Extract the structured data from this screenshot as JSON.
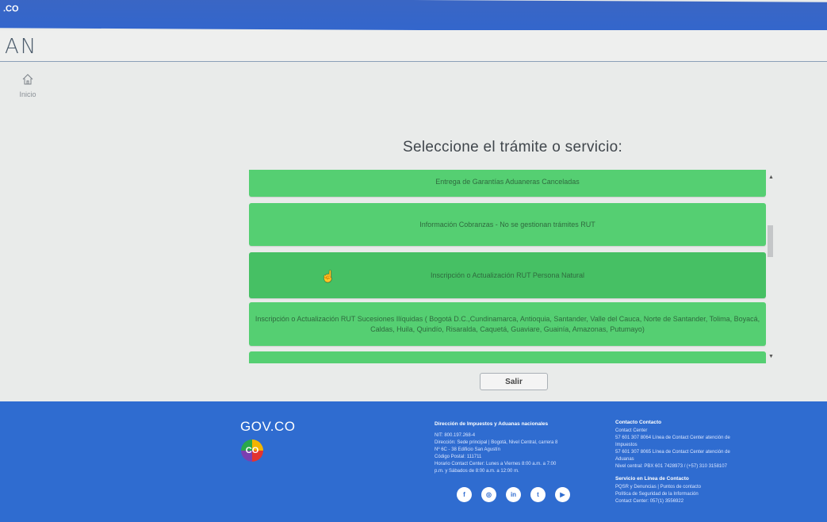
{
  "topbar": {
    "govco_label": ".CO"
  },
  "header": {
    "brand": "AN"
  },
  "sidebar": {
    "home_label": "Inicio"
  },
  "main": {
    "title": "Seleccione el trámite o servicio:",
    "items": [
      "Entrega de Garantías Aduaneras Canceladas",
      "Información Cobranzas - No se gestionan trámites RUT",
      "Inscripción o Actualización RUT Persona Natural",
      "Inscripción o Actualización RUT Sucesiones Ilíquidas ( Bogotá D.C.,Cundinamarca, Antioquia, Santander, Valle del Cauca, Norte de Santander, Tolima, Boyacá, Caldas, Huila, Quindío, Risaralda, Caquetá, Guaviare, Guainía, Amazonas, Putumayo)",
      ""
    ],
    "exit_label": "Salir"
  },
  "footer": {
    "govco_logo": "GOV.CO",
    "co_logo": "CO",
    "col1_heading": "Dirección de Impuestos y Aduanas nacionales",
    "col1_lines": [
      "NIT: 800.197.268-4",
      "Dirección: Sede principal | Bogotá, Nivel Central, carrera 8",
      "Nº 6C - 38 Edificio San Agustín",
      "Código Postal: 111711",
      "Horario Contact Center: Lunes a Viernes 8:00 a.m. a 7:00",
      "p.m. y Sábados de 8:00 a.m. a 12:00 m."
    ],
    "col2_heading": "Contacto Contacto",
    "col2_lines": [
      "Contact Center",
      "57 601 307 8064 Línea de Contact Center atención de",
      "Impuestos",
      "57 601 307 8065 Línea de Contact Center atención de",
      "Aduanas",
      "Nivel central: PBX 601 7428973 / (+57) 310 3158107"
    ],
    "col3_heading": "Servicio en Línea de Contacto",
    "col3_lines": [
      "PQSR y Denuncias | Puntos de contacto",
      "Política de Seguridad de la Información",
      "Contact Center: 057(1) 3556922"
    ],
    "socials": [
      "f",
      "◎",
      "in",
      "t",
      "▶"
    ]
  },
  "colors": {
    "accent_blue": "#3366cc",
    "item_green": "#55cf72",
    "footer_blue": "#2f6cd0"
  }
}
